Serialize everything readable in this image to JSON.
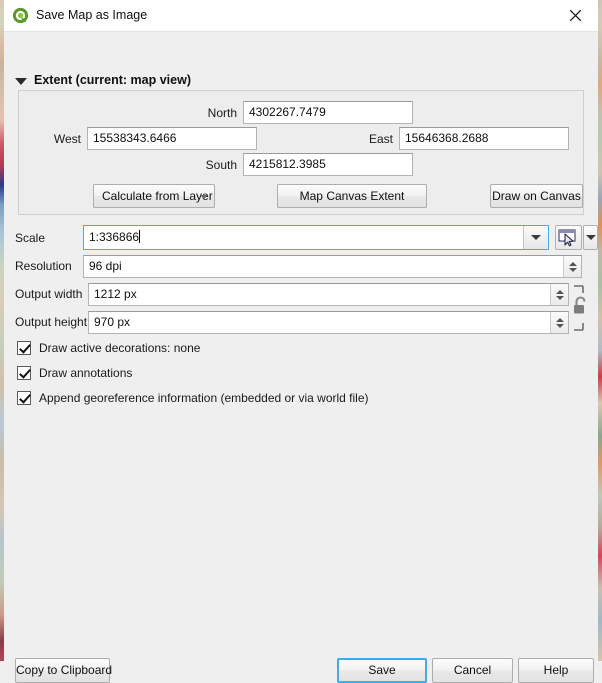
{
  "window": {
    "title": "Save Map as Image",
    "logo_icon": "qgis-logo-icon",
    "close_icon": "close-icon"
  },
  "extent_group": {
    "title": "Extent (current: map view)",
    "collapse_icon": "chevron-down-icon",
    "fields": {
      "north_label": "North",
      "north_value": "4302267.7479",
      "west_label": "West",
      "west_value": "15538343.6466",
      "east_label": "East",
      "east_value": "15646368.2688",
      "south_label": "South",
      "south_value": "4215812.3985"
    },
    "buttons": {
      "calculate_from_layer": "Calculate from Layer",
      "map_canvas_extent": "Map Canvas Extent",
      "draw_on_canvas": "Draw on Canvas"
    }
  },
  "scale": {
    "label": "Scale",
    "value": "1:336866",
    "dropdown_icon": "chevron-down-icon",
    "picker_icon": "set-to-canvas-extent-icon",
    "picker_menu_icon": "chevron-down-icon"
  },
  "resolution": {
    "label": "Resolution",
    "value": "96 dpi",
    "spinner_icon": "spinner-up-down-icon"
  },
  "output_width": {
    "label": "Output width",
    "value": "1212 px",
    "spinner_icon": "spinner-up-down-icon"
  },
  "output_height": {
    "label": "Output height",
    "value": "970 px",
    "spinner_icon": "spinner-up-down-icon"
  },
  "aspect_lock": {
    "icon": "unlocked-padlock-icon",
    "state": "unlocked"
  },
  "checkboxes": [
    {
      "label": "Draw active decorations: none",
      "checked": true
    },
    {
      "label": "Draw annotations",
      "checked": true
    },
    {
      "label": "Append georeference information (embedded or via world file)",
      "checked": true
    }
  ],
  "footer": {
    "copy_to_clipboard": "Copy to Clipboard",
    "save": "Save",
    "cancel": "Cancel",
    "help": "Help"
  },
  "colors": {
    "focus_blue": "#3daee9",
    "dialog_bg": "#efefef",
    "titlebar_bg": "#ffffff",
    "qgis_green": "#589632"
  }
}
